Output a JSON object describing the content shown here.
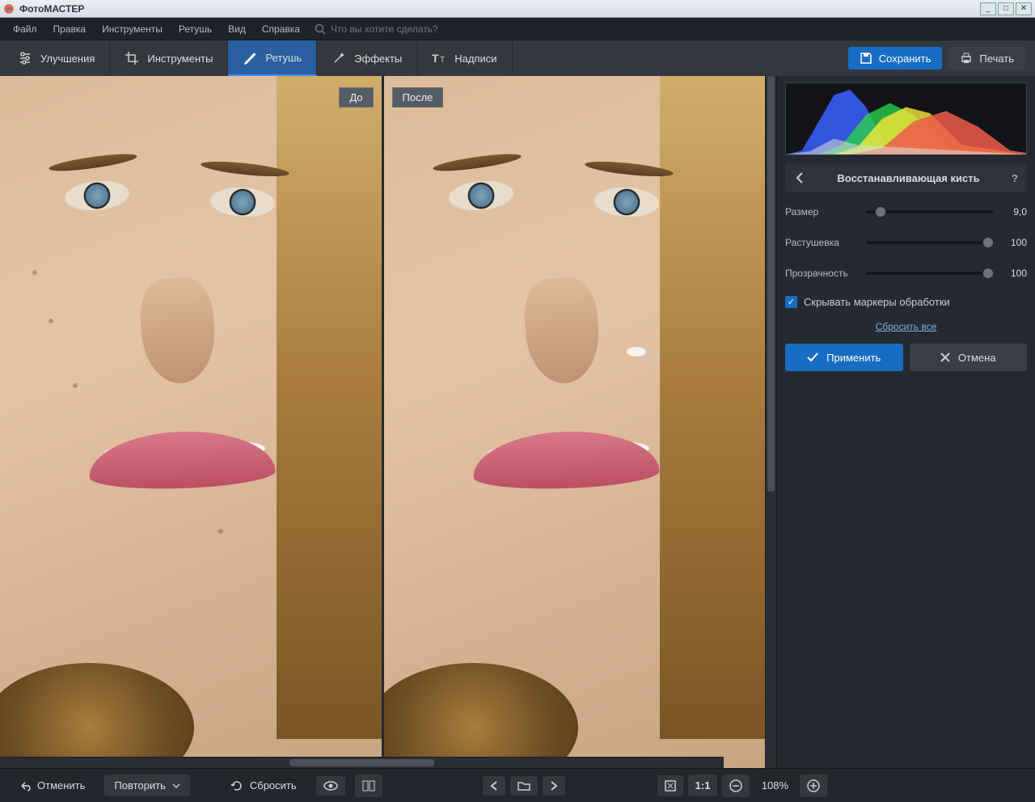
{
  "app": {
    "name": "ФотоМАСТЕР"
  },
  "menu": {
    "items": [
      "Файл",
      "Правка",
      "Инструменты",
      "Ретушь",
      "Вид",
      "Справка"
    ],
    "search_placeholder": "Что вы хотите сделать?"
  },
  "tabs": {
    "items": [
      {
        "label": "Улучшения",
        "icon": "sliders"
      },
      {
        "label": "Инструменты",
        "icon": "crop"
      },
      {
        "label": "Ретушь",
        "icon": "brush"
      },
      {
        "label": "Эффекты",
        "icon": "wand"
      },
      {
        "label": "Надписи",
        "icon": "text"
      }
    ],
    "active_index": 2,
    "save": "Сохранить",
    "print": "Печать"
  },
  "canvas": {
    "before_label": "До",
    "after_label": "После"
  },
  "panel": {
    "title": "Восстанавливающая кисть",
    "sliders": [
      {
        "label": "Размер",
        "value": "9,0",
        "pos": 7
      },
      {
        "label": "Растушевка",
        "value": "100",
        "pos": 95
      },
      {
        "label": "Прозрачность",
        "value": "100",
        "pos": 95
      }
    ],
    "hide_markers": "Скрывать маркеры обработки",
    "reset_all": "Сбросить все",
    "apply": "Применить",
    "cancel": "Отмена"
  },
  "bottom": {
    "undo": "Отменить",
    "redo": "Повторить",
    "reset": "Сбросить",
    "zoom": "108%"
  }
}
